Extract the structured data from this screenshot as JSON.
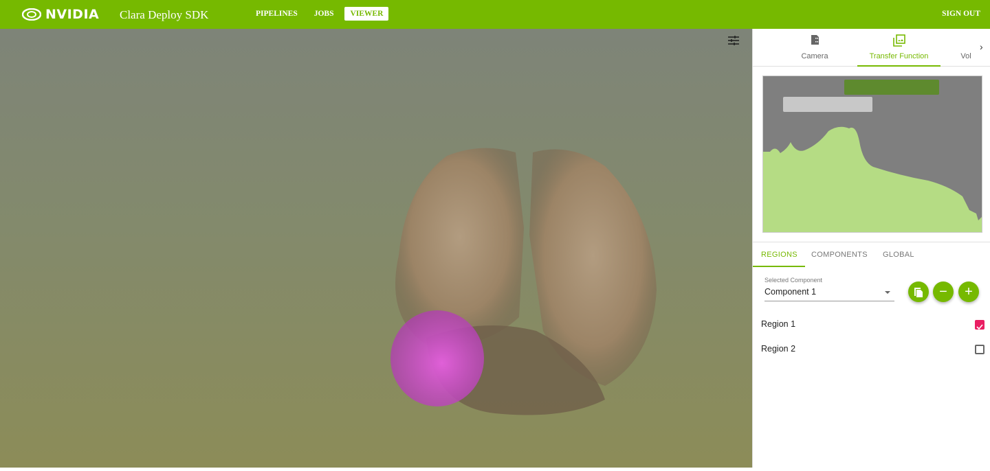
{
  "header": {
    "brand": "NVIDIA",
    "app_title": "Clara Deploy SDK",
    "nav": [
      "PIPELINES",
      "JOBS",
      "VIEWER"
    ],
    "active_nav": "VIEWER",
    "sign_out": "SIGN OUT",
    "brand_color": "#76b900"
  },
  "panel": {
    "tabs": [
      {
        "label": "Camera",
        "icon": "camera-icon"
      },
      {
        "label": "Transfer Function",
        "icon": "image-layers-icon",
        "active": true
      },
      {
        "label": "Vol",
        "icon": "volume-icon"
      }
    ],
    "subtabs": [
      "REGIONS",
      "COMPONENTS",
      "GLOBAL"
    ],
    "active_subtab": "REGIONS",
    "selected_component_label": "Selected Component",
    "selected_component": "Component 1",
    "regions": [
      {
        "label": "Region 1",
        "checked": true
      },
      {
        "label": "Region 2",
        "checked": false
      }
    ],
    "checkbox_color": "#e91e63"
  }
}
